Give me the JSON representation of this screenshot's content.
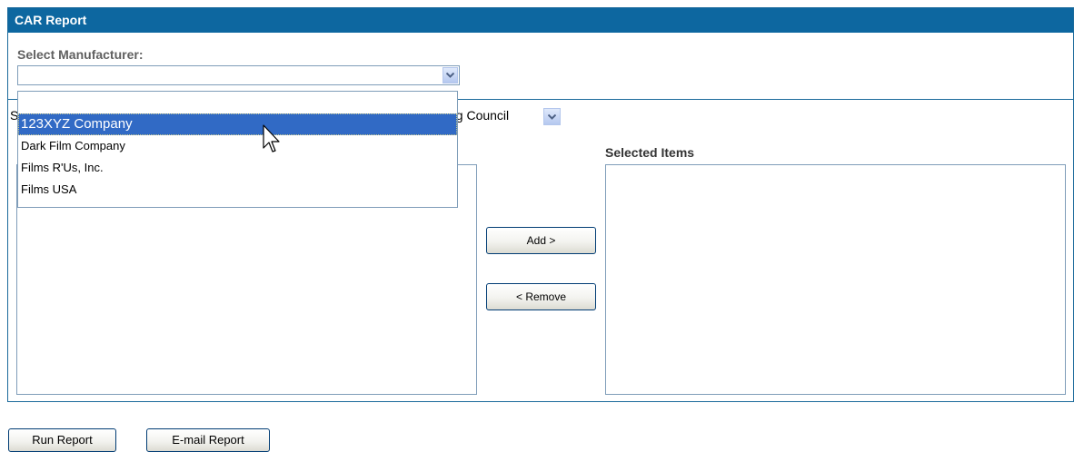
{
  "header": {
    "title": "CAR Report"
  },
  "manufacturer": {
    "label": "Select Manufacturer:",
    "value": "",
    "options": [
      "",
      "123XYZ Company",
      "Dark Film Company",
      "Films R'Us, Inc.",
      "Films USA"
    ],
    "highlighted": "123XYZ Company"
  },
  "second_select": {
    "label_fragment": "S",
    "value_fragment": "ng Council"
  },
  "lists": {
    "selected_title": "Selected Items"
  },
  "buttons": {
    "add": "Add >",
    "remove": "< Remove",
    "run": "Run Report",
    "email": "E-mail Report"
  },
  "colors": {
    "header_bg": "#0d67a0",
    "selection": "#316ac5",
    "border": "#7f9db9"
  }
}
